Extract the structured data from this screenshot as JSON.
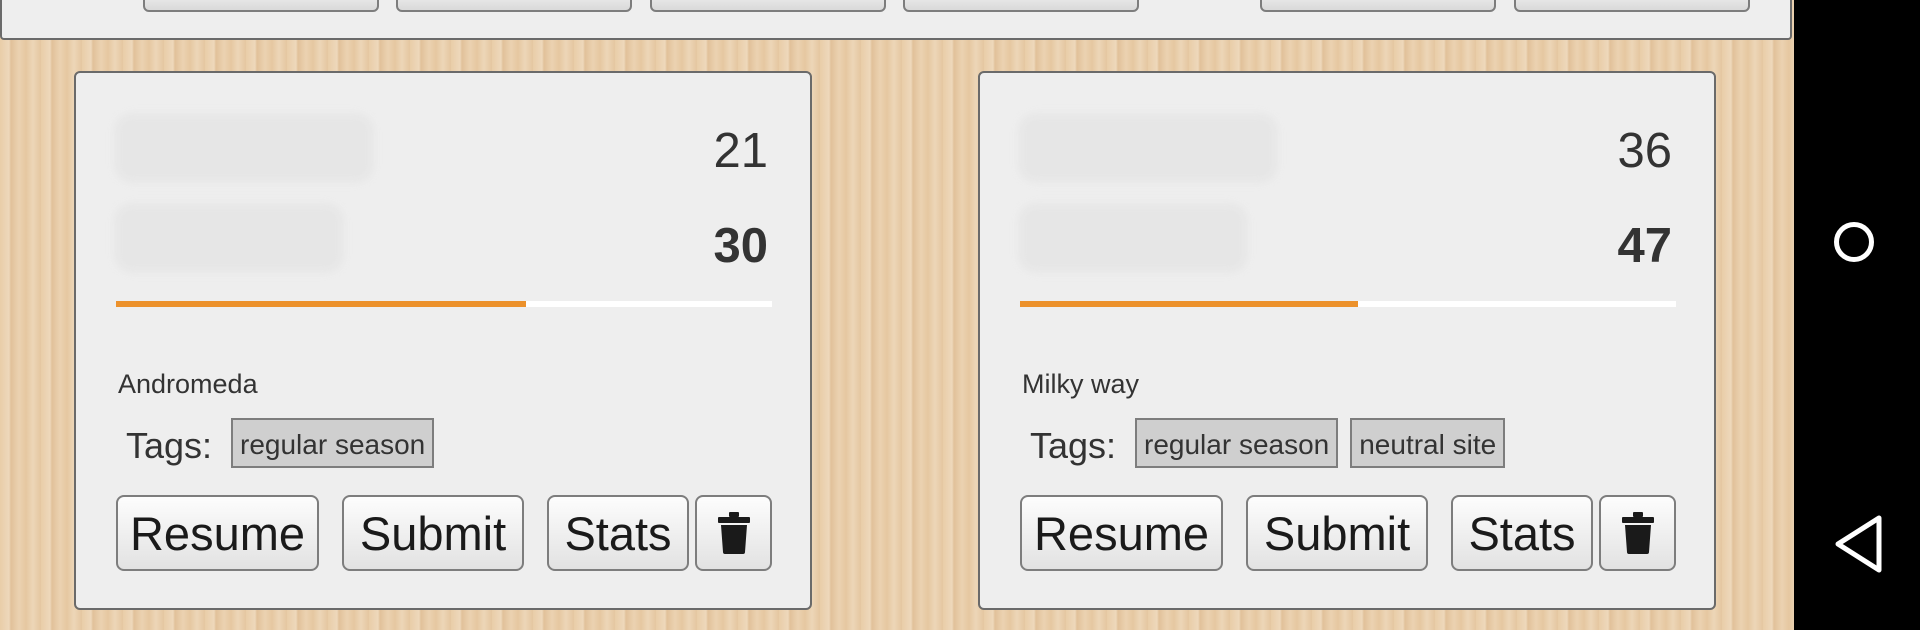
{
  "games": [
    {
      "score_top": "21",
      "score_bottom": "30",
      "progress": 0.625,
      "venue": "Andromeda",
      "tags_label": "Tags:",
      "tags": [
        "regular season"
      ],
      "buttons": {
        "resume": "Resume",
        "submit": "Submit",
        "stats": "Stats",
        "delete_icon": "trash-icon"
      }
    },
    {
      "score_top": "36",
      "score_bottom": "47",
      "progress": 0.515,
      "venue": "Milky way",
      "tags_label": "Tags:",
      "tags": [
        "regular season",
        "neutral site"
      ],
      "buttons": {
        "resume": "Resume",
        "submit": "Submit",
        "stats": "Stats",
        "delete_icon": "trash-icon"
      }
    }
  ],
  "navbar": {
    "home_icon": "home-circle-icon",
    "back_icon": "back-triangle-icon"
  },
  "colors": {
    "accent": "#ec912b",
    "card_bg": "#eeeeee",
    "navbar_bg": "#000000"
  }
}
